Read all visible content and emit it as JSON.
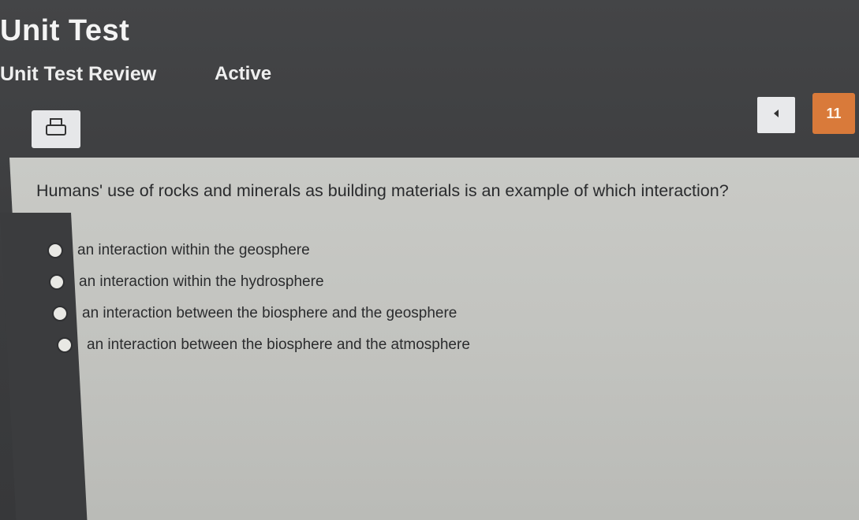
{
  "header": {
    "title": "Unit Test",
    "subtitle": "Unit Test Review",
    "status": "Active"
  },
  "toolbar": {
    "print_icon": "print-icon",
    "prev_icon": "caret-left-icon",
    "question_number": "11"
  },
  "question": {
    "text": "Humans' use of rocks and minerals as building materials is an example of which interaction?",
    "options": [
      "an interaction within the geosphere",
      "an interaction within the hydrosphere",
      "an interaction between the biosphere and the geosphere",
      "an interaction between the biosphere and the atmosphere"
    ]
  },
  "colors": {
    "accent": "#d97a3a",
    "background": "#3d3e40",
    "panel": "#c4c5c1"
  }
}
